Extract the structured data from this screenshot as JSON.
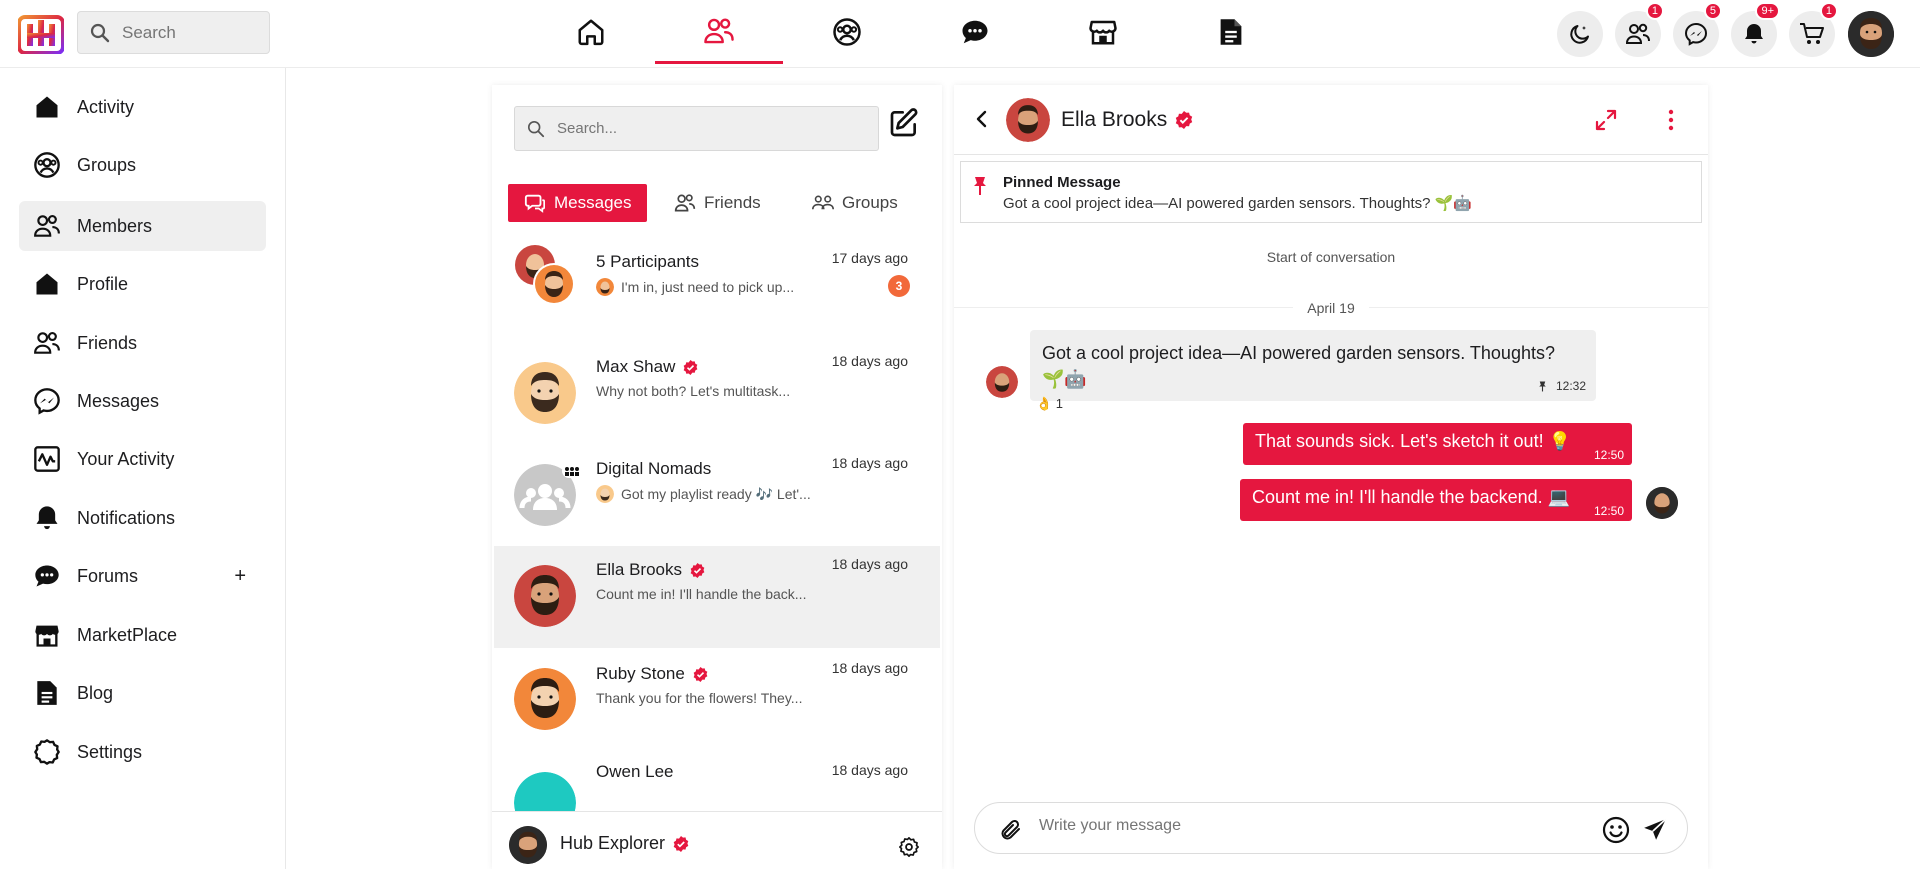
{
  "brand": {
    "accent": "#e5173f",
    "unread": "#f2693a"
  },
  "top": {
    "search_placeholder": "Search",
    "nav": [
      {
        "icon": "home-icon"
      },
      {
        "icon": "members-icon",
        "active": true
      },
      {
        "icon": "groups-icon"
      },
      {
        "icon": "forums-icon"
      },
      {
        "icon": "marketplace-icon"
      },
      {
        "icon": "blog-icon"
      }
    ],
    "badges": {
      "friends": "1",
      "messages": "5",
      "notifications": "9+",
      "cart": "1"
    }
  },
  "sidebar": {
    "items": [
      {
        "label": "Activity",
        "icon": "home-icon"
      },
      {
        "label": "Groups",
        "icon": "groups-icon"
      },
      {
        "label": "Members",
        "icon": "members-icon",
        "active": true
      },
      {
        "label": "Profile",
        "icon": "home-icon"
      },
      {
        "label": "Friends",
        "icon": "friends-icon"
      },
      {
        "label": "Messages",
        "icon": "messenger-icon"
      },
      {
        "label": "Your Activity",
        "icon": "activity-chart-icon"
      },
      {
        "label": "Notifications",
        "icon": "bell-icon"
      },
      {
        "label": "Forums",
        "icon": "forums-icon",
        "plus": "+"
      },
      {
        "label": "MarketPlace",
        "icon": "store-icon"
      },
      {
        "label": "Blog",
        "icon": "document-icon"
      },
      {
        "label": "Settings",
        "icon": "settings-icon"
      }
    ]
  },
  "list": {
    "search_placeholder": "Search...",
    "tabs": [
      {
        "label": "Messages",
        "active": true
      },
      {
        "label": "Friends"
      },
      {
        "label": "Groups"
      }
    ],
    "conversations": [
      {
        "name": "5 Participants",
        "preview": "I'm in, just need to pick up...",
        "time": "17 days ago",
        "unread": "3"
      },
      {
        "name": "Max Shaw",
        "verified": true,
        "preview": "Why not both? Let's multitask...",
        "time": "18 days ago"
      },
      {
        "name": "Digital Nomads",
        "preview": "Got my playlist ready 🎶 Let'...",
        "time": "18 days ago"
      },
      {
        "name": "Ella Brooks",
        "verified": true,
        "preview": "Count me in! I'll handle the back...",
        "time": "18 days ago",
        "active": true
      },
      {
        "name": "Ruby Stone",
        "verified": true,
        "preview": "Thank you for the flowers! They...",
        "time": "18 days ago"
      },
      {
        "name": "Owen Lee",
        "preview": "",
        "time": "18 days ago"
      }
    ],
    "footer": {
      "name": "Hub Explorer"
    }
  },
  "chat": {
    "name": "Ella Brooks",
    "pinned_title": "Pinned Message",
    "pinned_text": "Got a cool project idea—AI powered garden sensors. Thoughts? 🌱🤖",
    "start": "Start of conversation",
    "date": "April 19",
    "messages": [
      {
        "dir": "in",
        "text": "Got a cool project idea—AI powered garden sensors. Thoughts? 🌱🤖",
        "time": "12:32",
        "reaction": "👌 1"
      },
      {
        "dir": "out",
        "text": "That sounds sick. Let's sketch it out! 💡",
        "time": "12:50"
      },
      {
        "dir": "out",
        "text": "Count me in! I'll handle the backend. 💻",
        "time": "12:50"
      }
    ],
    "composer_placeholder": "Write your message"
  }
}
